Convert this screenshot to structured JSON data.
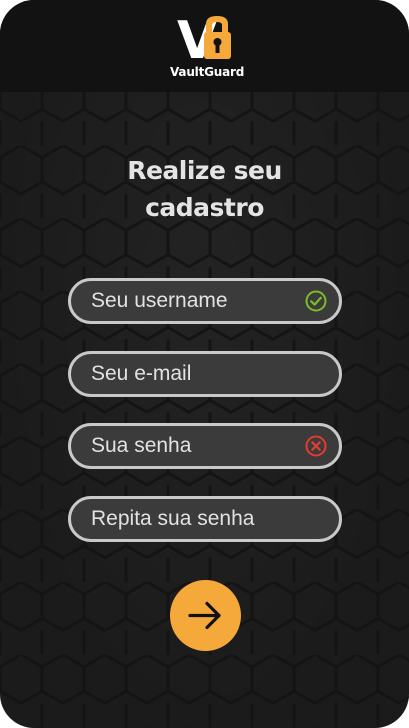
{
  "brand": {
    "name": "VaultGuard",
    "monogram_v": "V",
    "monogram_g": "G"
  },
  "title": "Realize seu\ncadastro",
  "fields": [
    {
      "placeholder": "Seu username",
      "value": "",
      "status": "valid"
    },
    {
      "placeholder": "Seu e-mail",
      "value": "",
      "status": "none"
    },
    {
      "placeholder": "Sua senha",
      "value": "",
      "status": "invalid"
    },
    {
      "placeholder": "Repita sua senha",
      "value": "",
      "status": "none"
    }
  ],
  "icons": {
    "valid": "check-circle-icon",
    "invalid": "x-circle-icon",
    "next": "arrow-right-icon"
  },
  "colors": {
    "accent": "#f6a93b",
    "background": "#1b1b1b",
    "header": "#121212",
    "field_fill": "#3b3b3b",
    "field_border": "#c9c9c9",
    "valid": "#7dbb2a",
    "invalid": "#e53b2f"
  }
}
